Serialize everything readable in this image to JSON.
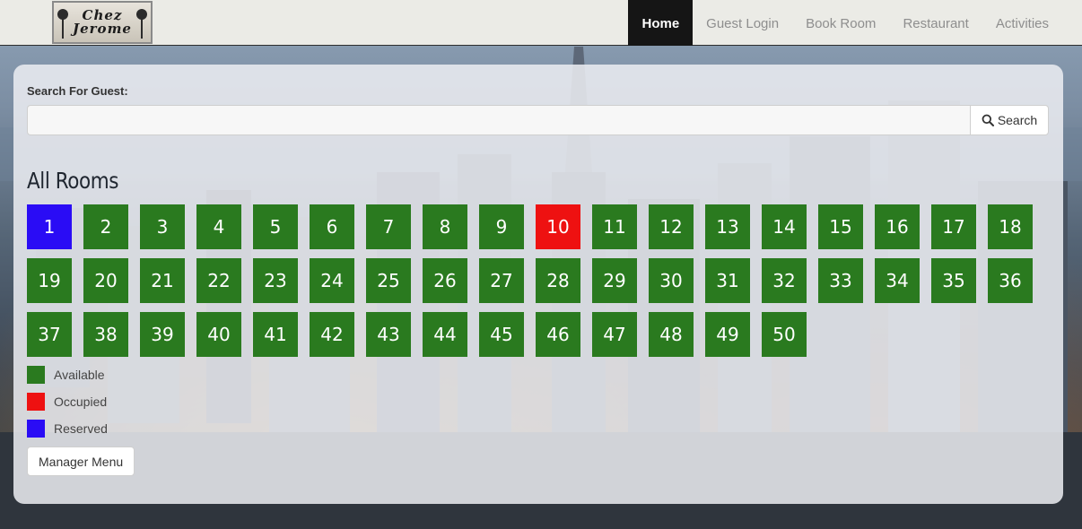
{
  "nav": {
    "logo_text": "Chez\nJerome",
    "links": [
      {
        "label": "Home",
        "active": true
      },
      {
        "label": "Guest Login",
        "active": false
      },
      {
        "label": "Book Room",
        "active": false
      },
      {
        "label": "Restaurant",
        "active": false
      },
      {
        "label": "Activities",
        "active": false
      }
    ]
  },
  "search": {
    "label": "Search For Guest:",
    "value": "",
    "placeholder": "",
    "button_label": "Search",
    "button_icon": "search-icon"
  },
  "rooms": {
    "heading": "All Rooms",
    "items": [
      {
        "number": "1",
        "status": "reserved"
      },
      {
        "number": "2",
        "status": "available"
      },
      {
        "number": "3",
        "status": "available"
      },
      {
        "number": "4",
        "status": "available"
      },
      {
        "number": "5",
        "status": "available"
      },
      {
        "number": "6",
        "status": "available"
      },
      {
        "number": "7",
        "status": "available"
      },
      {
        "number": "8",
        "status": "available"
      },
      {
        "number": "9",
        "status": "available"
      },
      {
        "number": "10",
        "status": "occupied"
      },
      {
        "number": "11",
        "status": "available"
      },
      {
        "number": "12",
        "status": "available"
      },
      {
        "number": "13",
        "status": "available"
      },
      {
        "number": "14",
        "status": "available"
      },
      {
        "number": "15",
        "status": "available"
      },
      {
        "number": "16",
        "status": "available"
      },
      {
        "number": "17",
        "status": "available"
      },
      {
        "number": "18",
        "status": "available"
      },
      {
        "number": "19",
        "status": "available"
      },
      {
        "number": "20",
        "status": "available"
      },
      {
        "number": "21",
        "status": "available"
      },
      {
        "number": "22",
        "status": "available"
      },
      {
        "number": "23",
        "status": "available"
      },
      {
        "number": "24",
        "status": "available"
      },
      {
        "number": "25",
        "status": "available"
      },
      {
        "number": "26",
        "status": "available"
      },
      {
        "number": "27",
        "status": "available"
      },
      {
        "number": "28",
        "status": "available"
      },
      {
        "number": "29",
        "status": "available"
      },
      {
        "number": "30",
        "status": "available"
      },
      {
        "number": "31",
        "status": "available"
      },
      {
        "number": "32",
        "status": "available"
      },
      {
        "number": "33",
        "status": "available"
      },
      {
        "number": "34",
        "status": "available"
      },
      {
        "number": "35",
        "status": "available"
      },
      {
        "number": "36",
        "status": "available"
      },
      {
        "number": "37",
        "status": "available"
      },
      {
        "number": "38",
        "status": "available"
      },
      {
        "number": "39",
        "status": "available"
      },
      {
        "number": "40",
        "status": "available"
      },
      {
        "number": "41",
        "status": "available"
      },
      {
        "number": "42",
        "status": "available"
      },
      {
        "number": "43",
        "status": "available"
      },
      {
        "number": "44",
        "status": "available"
      },
      {
        "number": "45",
        "status": "available"
      },
      {
        "number": "46",
        "status": "available"
      },
      {
        "number": "47",
        "status": "available"
      },
      {
        "number": "48",
        "status": "available"
      },
      {
        "number": "49",
        "status": "available"
      },
      {
        "number": "50",
        "status": "available"
      }
    ]
  },
  "legend": [
    {
      "key": "available",
      "label": "Available",
      "color": "#2a7a1f"
    },
    {
      "key": "occupied",
      "label": "Occupied",
      "color": "#ee1111"
    },
    {
      "key": "reserved",
      "label": "Reserved",
      "color": "#2a0cf5"
    }
  ],
  "manager_button_label": "Manager Menu",
  "colors": {
    "available": "#2a7a1f",
    "occupied": "#ee1111",
    "reserved": "#2a0cf5",
    "nav_active_bg": "#151515"
  }
}
